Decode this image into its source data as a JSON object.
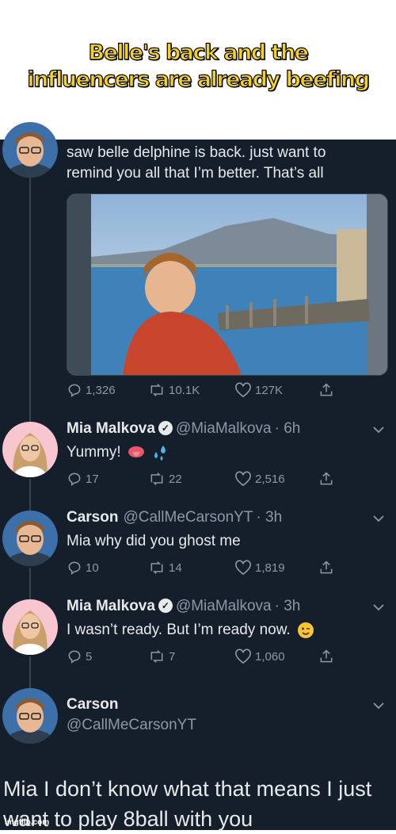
{
  "caption": {
    "line1": "Belle's back and the",
    "line2": "influencers are already beefing"
  },
  "main_tweet": {
    "text_line1": "saw belle delphine is back. just want to",
    "text_line2": "remind you all that I’m better. That’s all",
    "replies": "1,326",
    "retweets": "10.1K",
    "likes": "127K"
  },
  "reply1": {
    "name": "Mia Malkova",
    "handle": "@MiaMalkova",
    "time": "· 6h",
    "text": "Yummy!",
    "emojis": [
      "tongue-emoji",
      "sweat-droplets-emoji"
    ],
    "replies": "17",
    "retweets": "22",
    "likes": "2,516"
  },
  "reply2": {
    "name": "Carson",
    "handle": "@CallMeCarsonYT",
    "time": "· 3h",
    "text": "Mia why did you ghost me",
    "replies": "10",
    "retweets": "14",
    "likes": "1,819"
  },
  "reply3": {
    "name": "Mia Malkova",
    "handle": "@MiaMalkova",
    "time": "· 3h",
    "text": "I wasn’t ready. But I’m ready now.",
    "emojis": [
      "wink-emoji"
    ],
    "replies": "5",
    "retweets": "7",
    "likes": "1,060"
  },
  "final_tweet": {
    "name": "Carson",
    "handle": "@CallMeCarsonYT",
    "text_line1": "Mia I don’t know what that means I just",
    "text_line2": "want to play 8ball with you"
  },
  "watermark": "imgflip.com",
  "colors": {
    "background": "#151f2b",
    "text": "#e7e9ea",
    "muted": "#8b98a5",
    "caption_fill": "#f6d02a"
  }
}
